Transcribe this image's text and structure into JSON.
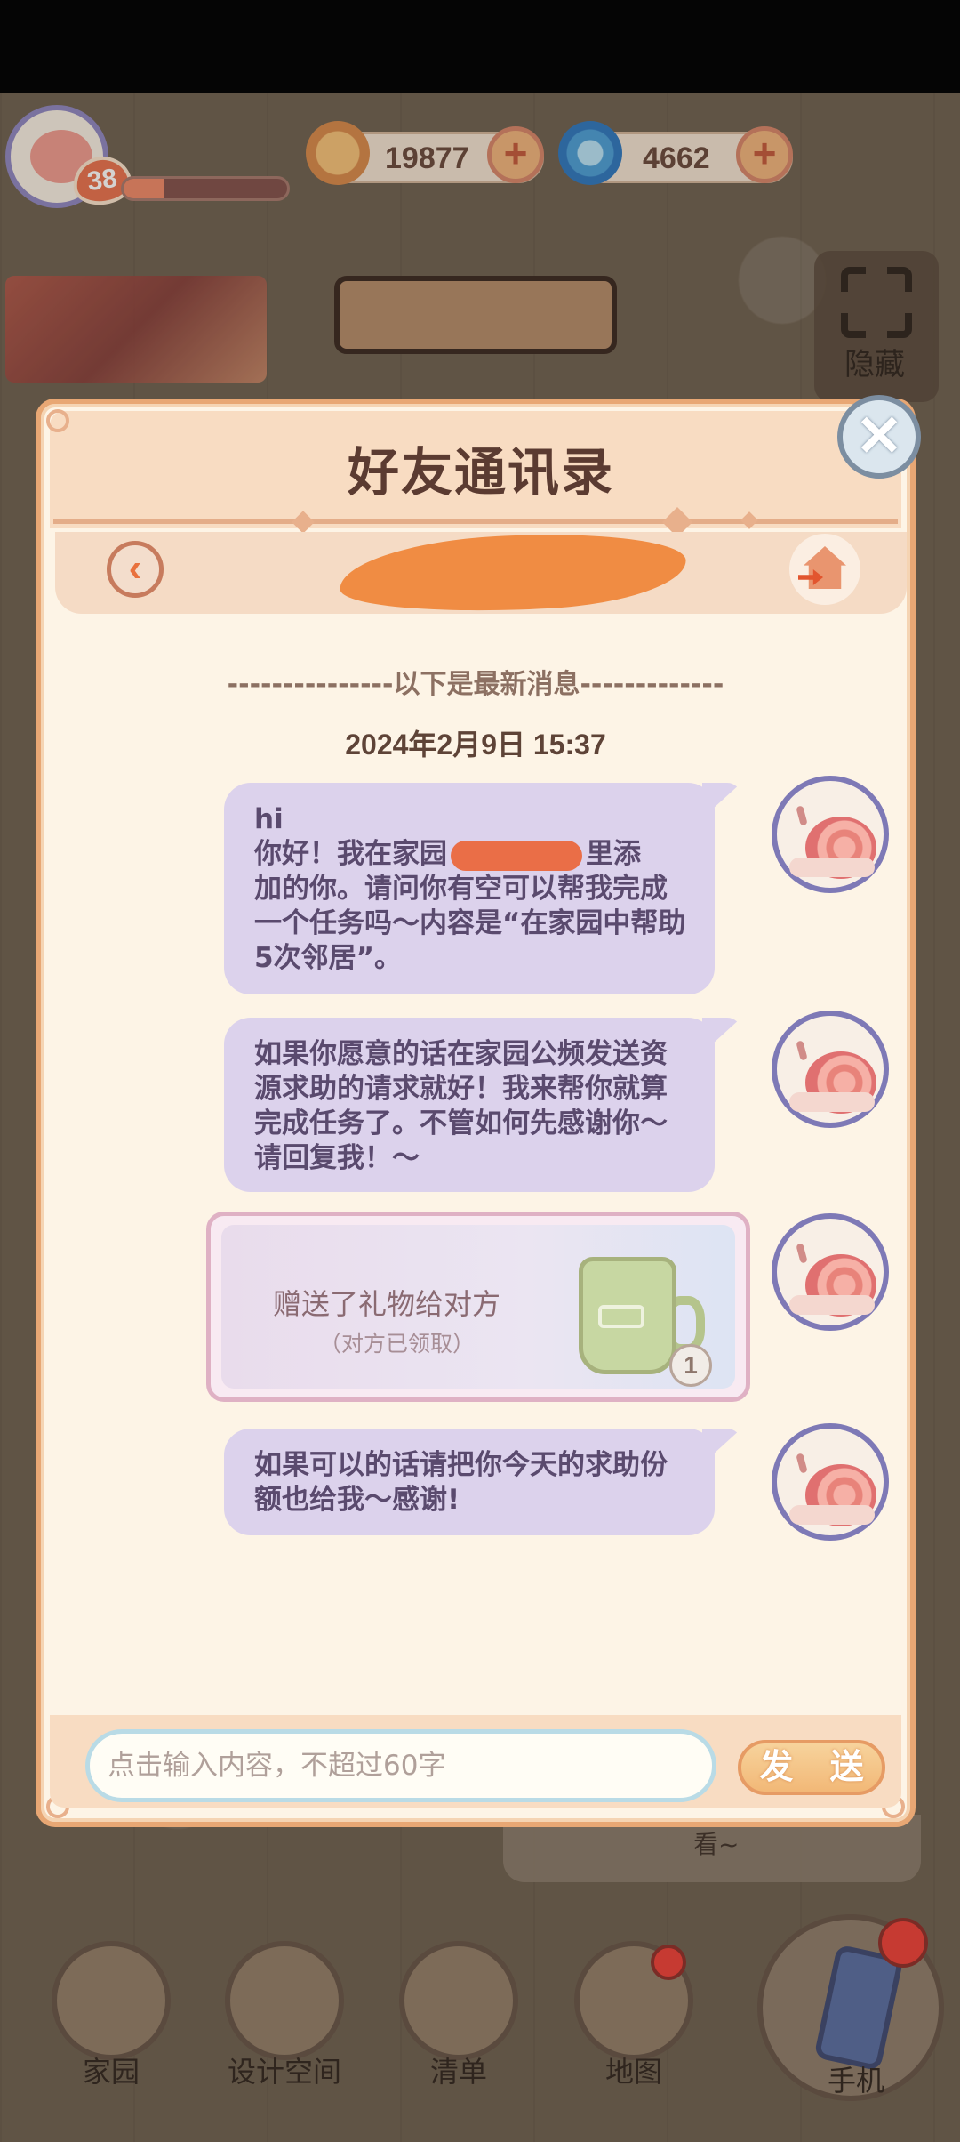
{
  "hud": {
    "level": "38",
    "exp_fraction": 0.25,
    "coins": "19877",
    "gems": "4662",
    "hide_label": "隐藏"
  },
  "dialog": {
    "title": "好友通讯录",
    "divider": "---------------以下是最新消息-------------",
    "timestamp": "2024年2月9日  15:37",
    "messages": [
      {
        "line1": "hi",
        "line2a": "你好！我在家园",
        "line2b": "里添",
        "rest": "加的你。请问你有空可以帮我完成一个任务吗～内容是“在家园中帮助5次邻居”。"
      },
      {
        "text": "如果你愿意的话在家园公频发送资源求助的请求就好！我来帮你就算完成任务了。不管如何先感谢你～请回复我！～"
      },
      {
        "gift_title": "赠送了礼物给对方",
        "gift_status": "（对方已领取）",
        "gift_count": "1"
      },
      {
        "text": "如果可以的话请把你今天的求助份额也给我～感谢!"
      }
    ],
    "input_placeholder": "点击输入内容，不超过60字",
    "send_label": "发 送"
  },
  "background": {
    "behind_text": "看~"
  },
  "bottom_nav": {
    "items": [
      "家园",
      "设计空间",
      "清单",
      "地图"
    ],
    "phone": "手机"
  },
  "colors": {
    "dialog_bg": "#fdf4e6",
    "bubble": "#dcd2ec",
    "accent": "#e8a774"
  },
  "icons": [
    "coin-icon",
    "gem-icon",
    "plus-icon",
    "fullscreen-icon",
    "close-icon",
    "back-arrow-icon",
    "home-icon",
    "snail-avatar-icon",
    "mug-gift-icon",
    "house-nav-icon",
    "design-nav-icon",
    "list-nav-icon",
    "map-pin-icon",
    "phone-icon"
  ]
}
